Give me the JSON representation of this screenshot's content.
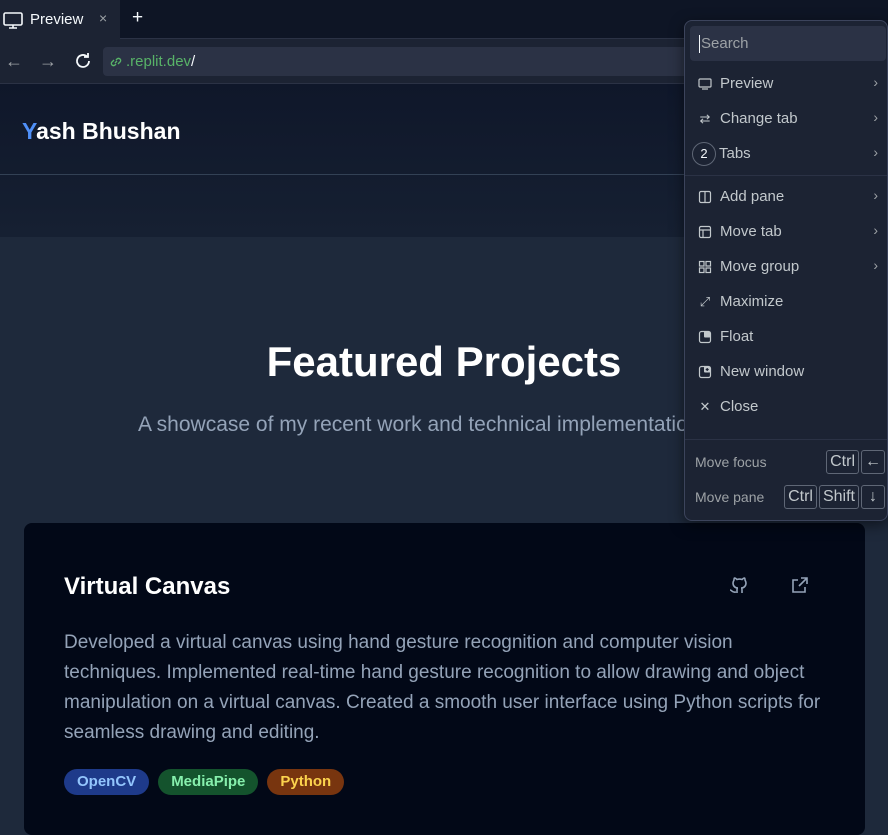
{
  "tab": {
    "title": "Preview",
    "close": "×",
    "new_tab": "+"
  },
  "address": {
    "domain": ".replit.dev",
    "path": "/"
  },
  "site": {
    "logo_first": "Y",
    "logo_rest": "ash Bhushan",
    "heading": "Featured Projects",
    "subheading": "A showcase of my recent work and technical implementations",
    "project": {
      "title": "Virtual Canvas",
      "description": "Developed a virtual canvas using hand gesture recognition and computer vision techniques. Implemented real-time hand gesture recognition to allow drawing and object manipulation on a virtual canvas. Created a smooth user interface using Python scripts for seamless drawing and editing.",
      "tags": [
        {
          "label": "OpenCV",
          "bg": "#1e3a8a",
          "fg": "#93c5fd"
        },
        {
          "label": "MediaPipe",
          "bg": "#14532d",
          "fg": "#86efac"
        },
        {
          "label": "Python",
          "bg": "#78350f",
          "fg": "#fcd34d"
        }
      ]
    }
  },
  "menu": {
    "search_placeholder": "Search",
    "items": [
      {
        "label": "Preview",
        "icon": "monitor-icon"
      },
      {
        "label": "Change tab",
        "icon": "swap-icon"
      },
      {
        "label": "Tabs",
        "badge": "2"
      },
      {
        "label": "Add pane",
        "icon": "split-pane-icon"
      },
      {
        "label": "Move tab",
        "icon": "layout-icon"
      },
      {
        "label": "Move group",
        "icon": "grid-icon"
      },
      {
        "label": "Maximize",
        "icon": "maximize-icon"
      },
      {
        "label": "Float",
        "icon": "float-icon"
      },
      {
        "label": "New window",
        "icon": "new-window-icon"
      },
      {
        "label": "Close",
        "icon": "close-icon"
      }
    ],
    "shortcuts": [
      {
        "label": "Move focus",
        "keys": [
          "Ctrl",
          "←"
        ]
      },
      {
        "label": "Move pane",
        "keys": [
          "Ctrl",
          "Shift",
          "↓"
        ]
      }
    ]
  },
  "colors": {
    "accent": "#4f8ff7",
    "link": "#58b368",
    "card_bg": "#020817"
  }
}
